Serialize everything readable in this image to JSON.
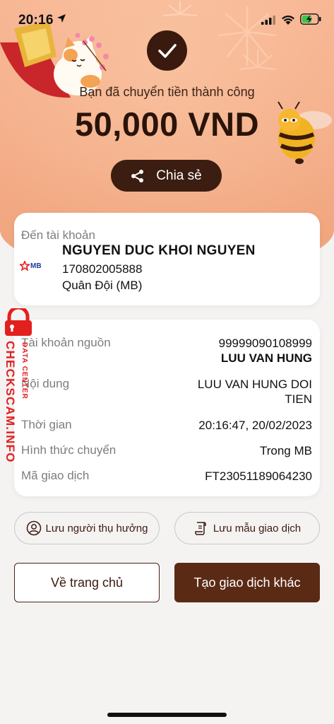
{
  "status_bar": {
    "time": "20:16",
    "location_icon": "location-arrow-icon",
    "signal_icon": "cellular-signal-icon",
    "wifi_icon": "wifi-icon",
    "battery_icon": "battery-charging-icon"
  },
  "hero": {
    "success_message": "Bạn đã chuyển tiền thành công",
    "amount": "50,000 VND",
    "share_label": "Chia sẻ",
    "check_icon": "checkmark-icon"
  },
  "recipient": {
    "label": "Đến tài khoản",
    "name": "NGUYEN DUC KHOI NGUYEN",
    "account_number": "170802005888",
    "bank": "Quân Đội (MB)",
    "bank_logo_text": "MB"
  },
  "details": {
    "rows": [
      {
        "label": "Tài khoản nguồn",
        "value": "99999090108999",
        "value2": "LUU VAN HUNG"
      },
      {
        "label": "Nội dung",
        "value": "LUU VAN HUNG DOI",
        "value2": "TIEN"
      },
      {
        "label": "Thời gian",
        "value": "20:16:47, 20/02/2023"
      },
      {
        "label": "Hình thức chuyển",
        "value": "Trong MB"
      },
      {
        "label": "Mã giao dịch",
        "value": "FT23051189064230"
      }
    ]
  },
  "actions": {
    "save_beneficiary": "Lưu người thụ hưởng",
    "save_template": "Lưu mẫu giao dịch",
    "home": "Về trang chủ",
    "new_transaction": "Tạo giao dịch khác"
  },
  "watermark": {
    "main": "CHECKSCAM.INFO",
    "sub": "DATA CENTER"
  },
  "colors": {
    "hero_bg": "#f4ad88",
    "primary_dark": "#3c1d12",
    "button_brown": "#5b2a15",
    "watermark_red": "#e2201f"
  }
}
